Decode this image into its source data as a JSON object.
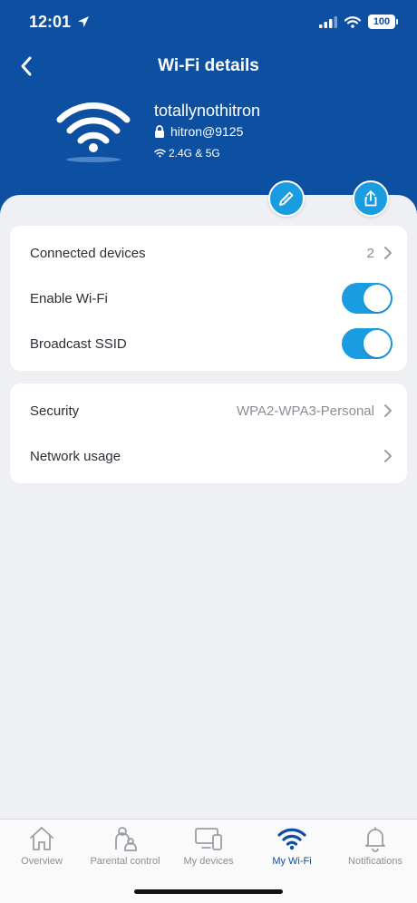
{
  "status": {
    "time": "12:01",
    "battery": "100"
  },
  "header": {
    "title": "Wi-Fi details",
    "network_name": "totallynothitron",
    "password": "hitron@9125",
    "bands": "2.4G & 5G"
  },
  "details": {
    "connected_devices_label": "Connected devices",
    "connected_devices_count": "2",
    "enable_wifi_label": "Enable Wi-Fi",
    "broadcast_ssid_label": "Broadcast SSID"
  },
  "settings": {
    "security_label": "Security",
    "security_value": "WPA2-WPA3-Personal",
    "network_usage_label": "Network usage"
  },
  "tabs": [
    {
      "label": "Overview",
      "icon": "home-icon"
    },
    {
      "label": "Parental control",
      "icon": "parental-icon"
    },
    {
      "label": "My devices",
      "icon": "devices-icon"
    },
    {
      "label": "My Wi-Fi",
      "icon": "wifi-icon"
    },
    {
      "label": "Notifications",
      "icon": "bell-icon"
    }
  ],
  "colors": {
    "header": "#0d4fa0",
    "accent": "#1a9ce0",
    "background": "#eff0f4"
  }
}
